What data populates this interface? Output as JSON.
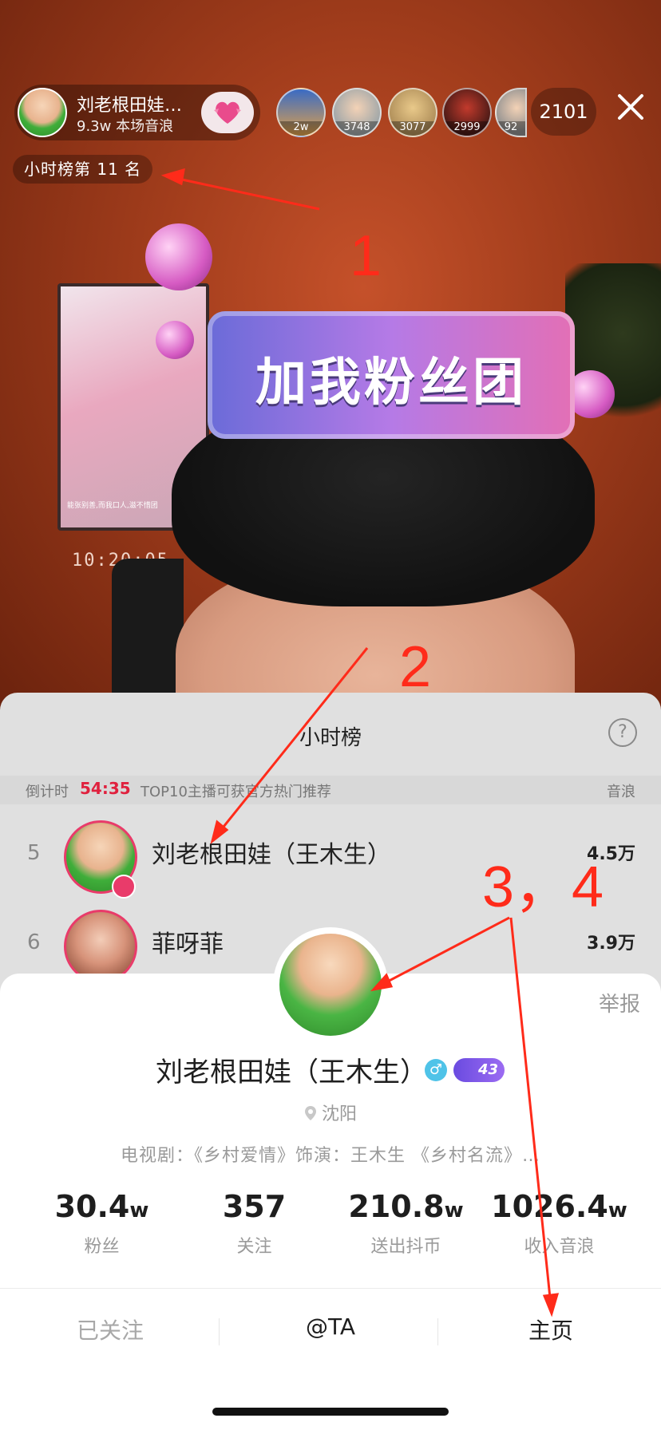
{
  "anchor": {
    "name": "刘老根田娃…",
    "sub": "9.3w 本场音浪",
    "rank_label": "小时榜第 11 名"
  },
  "viewers": [
    {
      "badge": "2w"
    },
    {
      "badge": "3748"
    },
    {
      "badge": "3077"
    },
    {
      "badge": "2999"
    },
    {
      "badge": "92"
    }
  ],
  "viewer_count": "2101",
  "sticker_text": "加我粉丝团",
  "tv_caption": "能张别善,而我口人,滋不惜团",
  "clock_text": "10:20:05",
  "annotations": {
    "n1": "1",
    "n2": "2",
    "n34": "3，4",
    "color": "#ff2b1a"
  },
  "hourly": {
    "title": "小时榜",
    "help": "?",
    "countdown_label": "倒计时",
    "countdown": "54:35",
    "promo": "TOP10主播可获官方热门推荐",
    "unit_header": "音浪",
    "rows": [
      {
        "pos": "5",
        "name": "刘老根田娃（王木生）",
        "value": "4.5万"
      },
      {
        "pos": "6",
        "name": "菲呀菲",
        "value": "3.9万"
      }
    ]
  },
  "profile": {
    "report": "举报",
    "name": "刘老根田娃（王木生）",
    "gender": "♂",
    "level": "43",
    "location": "沈阳",
    "bio": "电视剧：《乡村爱情》饰演：王木生 《乡村名流》…",
    "stats": [
      {
        "value": "30.4",
        "unit": "w",
        "label": "粉丝"
      },
      {
        "value": "357",
        "unit": "",
        "label": "关注"
      },
      {
        "value": "210.8",
        "unit": "w",
        "label": "送出抖币"
      },
      {
        "value": "1026.4",
        "unit": "w",
        "label": "收入音浪"
      }
    ],
    "actions": {
      "followed": "已关注",
      "mention": "@TA",
      "home": "主页"
    }
  },
  "colors": {
    "accent_pink": "#e93b6a",
    "countdown_red": "#e0213e",
    "gender_blue": "#4fc3e8",
    "level_purple": "#7a55e8"
  }
}
